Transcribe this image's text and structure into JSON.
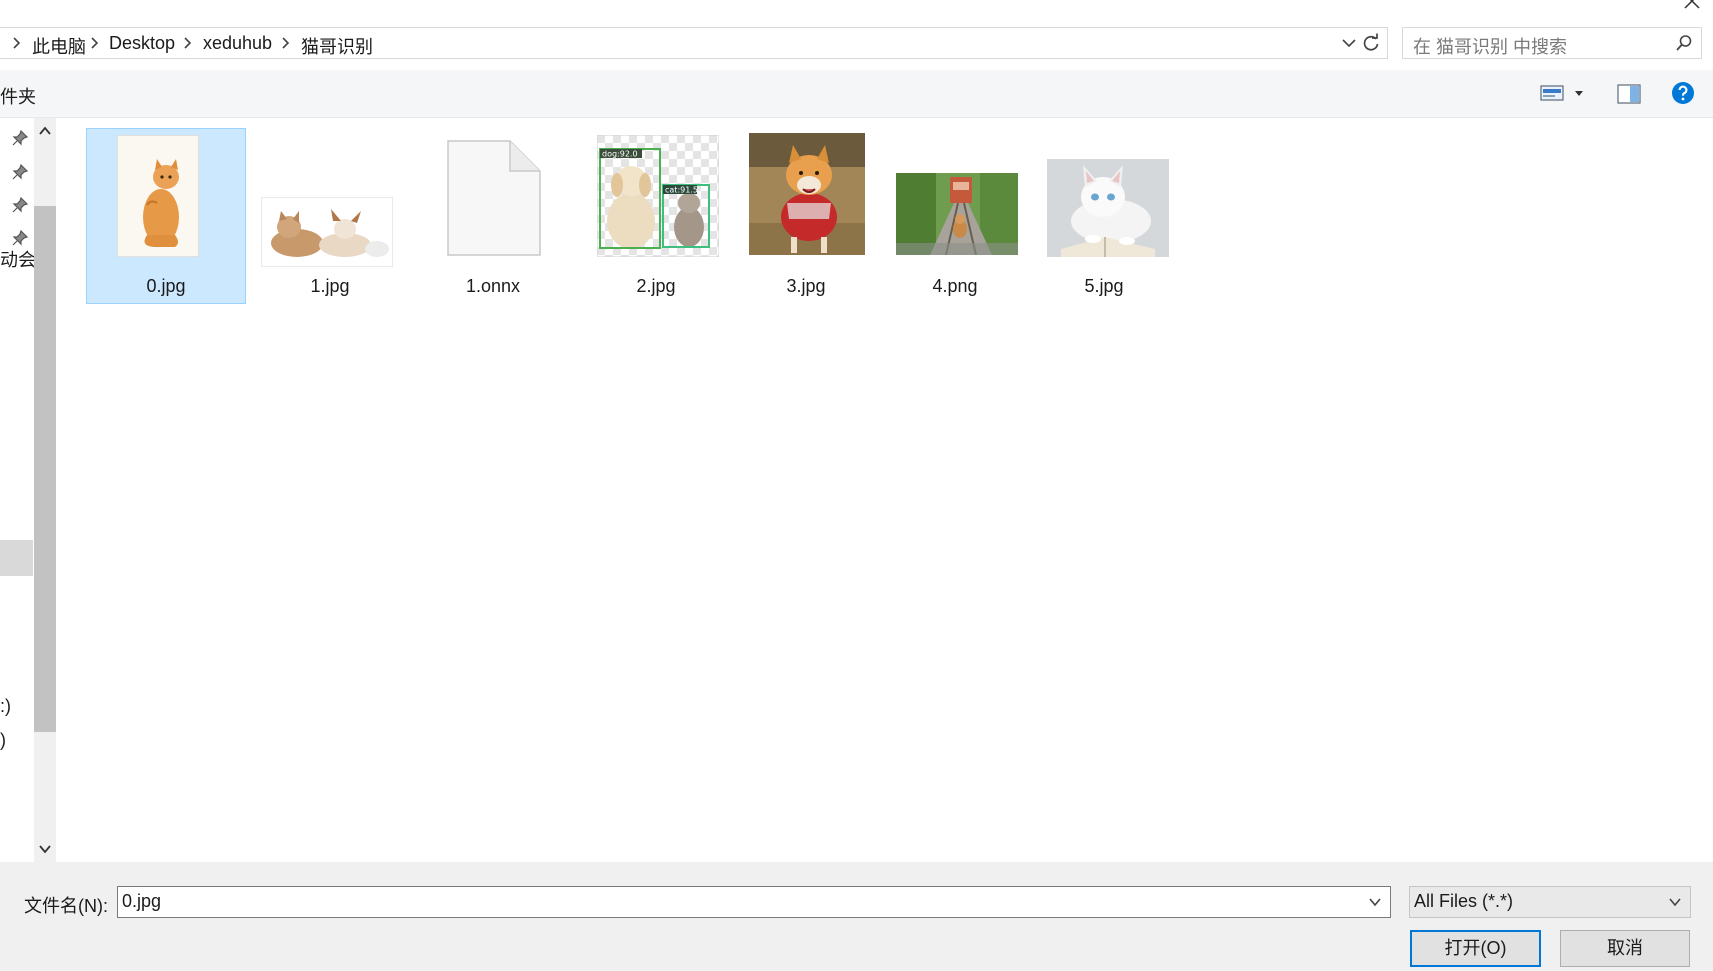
{
  "address_bar": {
    "breadcrumbs": [
      "此电脑",
      "Desktop",
      "xeduhub",
      "猫哥识别"
    ]
  },
  "search": {
    "placeholder": "在 猫哥识别 中搜索"
  },
  "toolbar": {
    "partial_label": "件夹"
  },
  "nav_pane": {
    "fragments": [
      "动会",
      ":)",
      ")"
    ]
  },
  "files": [
    {
      "name": "0.jpg",
      "selected": true,
      "kind": "cat-sitting"
    },
    {
      "name": "1.jpg",
      "selected": false,
      "kind": "cat-dog-lying"
    },
    {
      "name": "1.onnx",
      "selected": false,
      "kind": "generic-file"
    },
    {
      "name": "2.jpg",
      "selected": false,
      "kind": "detection-result",
      "box_labels": [
        "dog:92.0",
        "cat:91.5"
      ]
    },
    {
      "name": "3.jpg",
      "selected": false,
      "kind": "shiba-dog"
    },
    {
      "name": "4.png",
      "selected": false,
      "kind": "dog-on-tracks"
    },
    {
      "name": "5.jpg",
      "selected": false,
      "kind": "white-cat-book"
    }
  ],
  "bottom": {
    "filename_label": "文件名(N):",
    "filename_value": "0.jpg",
    "filetype_value": "All Files (*.*)",
    "open_button": "打开(O)",
    "cancel_button": "取消"
  },
  "colors": {
    "selection_bg": "#cce8ff",
    "selection_border": "#99d1ff",
    "primary_border": "#0078d7",
    "help_blue": "#0078d7"
  }
}
